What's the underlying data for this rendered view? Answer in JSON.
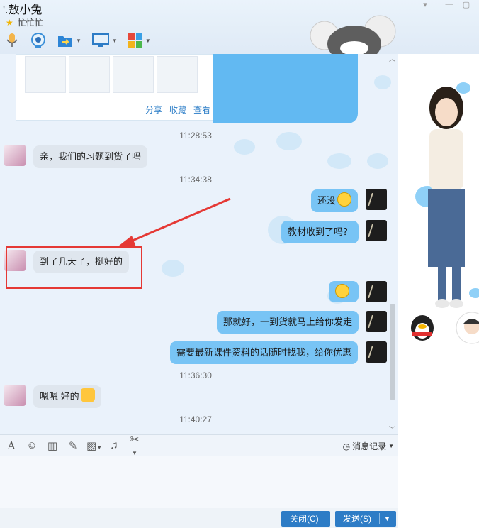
{
  "window": {
    "title": "'.敖小兔",
    "status": "忙忙忙"
  },
  "card": {
    "share": "分享",
    "collect": "收藏",
    "view": "查看"
  },
  "messages": [
    {
      "time": "11:28:53"
    },
    {
      "text": "亲，我们的习题到货了吗"
    },
    {
      "time": "11:34:38"
    },
    {
      "text": "还没"
    },
    {
      "text": "教材收到了吗？"
    },
    {
      "text": "到了几天了，挺好的"
    },
    {
      "text": "那就好，一到货就马上给你发走"
    },
    {
      "text": "需要最新课件资料的话随时找我，给你优惠"
    },
    {
      "time": "11:36:30"
    },
    {
      "text": "嗯嗯 好的"
    },
    {
      "time": "11:40:27"
    }
  ],
  "input": {
    "history": "消息记录"
  },
  "buttons": {
    "close": "关闭(C)",
    "send": "发送(S)"
  },
  "icons": [
    "mic-icon",
    "video-icon",
    "folder-send-icon",
    "screen-share-icon",
    "apps-icon",
    "font-icon",
    "emoji-icon",
    "magic-icon",
    "screenshot-edit-icon",
    "image-icon",
    "music-icon",
    "scissors-icon",
    "clock-icon"
  ],
  "colors": {
    "outgoing_bubble": "#78c4f5",
    "incoming_bubble": "#dfe6ee",
    "button": "#2d7cc6",
    "highlight": "#e53935"
  }
}
